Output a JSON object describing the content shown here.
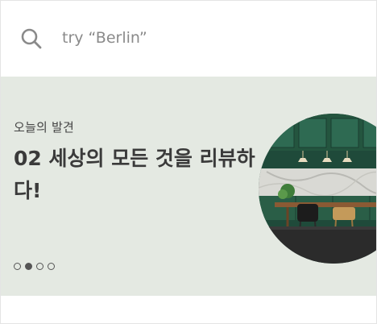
{
  "search": {
    "placeholder": "try “Berlin”",
    "value": ""
  },
  "banner": {
    "subtitle": "오늘의 발견",
    "title": "02 세상의 모든 것을 리뷰하다!",
    "image_name": "kitchen-interior-photo",
    "pager": {
      "count": 4,
      "active_index": 1
    }
  },
  "colors": {
    "banner_bg": "#e4e9e2",
    "text_dark": "#3a3a3a",
    "icon_gray": "#8a8a8a"
  }
}
